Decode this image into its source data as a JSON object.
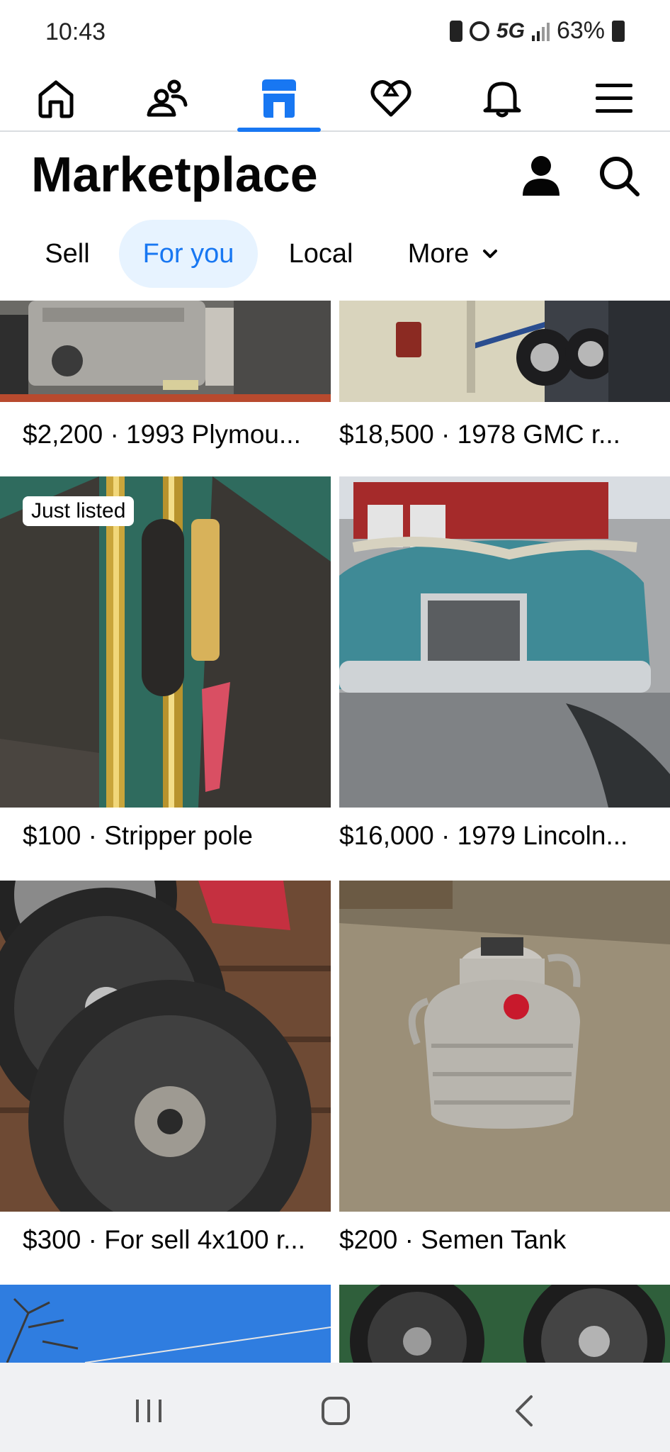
{
  "status_bar": {
    "time": "10:43",
    "network": "5G",
    "battery": "63%"
  },
  "nav": {
    "items": [
      {
        "icon": "home-icon",
        "active": false
      },
      {
        "icon": "friends-icon",
        "active": false
      },
      {
        "icon": "marketplace-icon",
        "active": true
      },
      {
        "icon": "dating-heart-icon",
        "active": false
      },
      {
        "icon": "bell-icon",
        "active": false
      },
      {
        "icon": "menu-icon",
        "active": false
      }
    ],
    "accent": "#1877f2"
  },
  "header": {
    "title": "Marketplace"
  },
  "chips": {
    "sell": "Sell",
    "for_you": "For you",
    "local": "Local",
    "more": "More"
  },
  "listings": [
    {
      "caption": "$2,200 · 1993 Plymou...",
      "badge": ""
    },
    {
      "caption": "$18,500 · 1978 GMC r...",
      "badge": ""
    },
    {
      "caption": "$100 · Stripper pole",
      "badge": "Just listed"
    },
    {
      "caption": "$16,000 · 1979 Lincoln...",
      "badge": ""
    },
    {
      "caption": "$300 · For sell 4x100 r...",
      "badge": ""
    },
    {
      "caption": "$200 · Semen Tank",
      "badge": ""
    }
  ]
}
